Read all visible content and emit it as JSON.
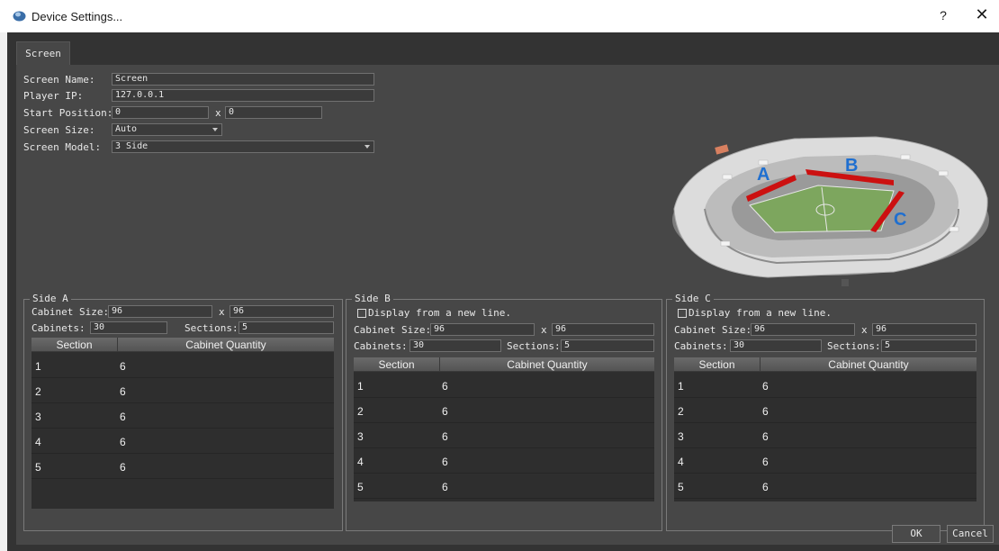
{
  "window": {
    "title": "Device Settings...",
    "help": "?",
    "close": "✕"
  },
  "tabs": [
    {
      "label": "Screen"
    }
  ],
  "form": {
    "screen_name_label": "Screen Name:",
    "screen_name_value": "Screen",
    "player_ip_label": "Player IP:",
    "player_ip_value": "127.0.0.1",
    "start_position_label": "Start Position:",
    "start_x": "0",
    "x_sep": "x",
    "start_y": "0",
    "screen_size_label": "Screen Size:",
    "screen_size_value": "Auto",
    "screen_model_label": "Screen Model:",
    "screen_model_value": "3 Side"
  },
  "preview": {
    "labels": [
      "A",
      "B",
      "C"
    ]
  },
  "sides": [
    {
      "title": "Side A",
      "cabinet_size_label": "Cabinet Size:",
      "cab_w": "96",
      "x_sep": "x",
      "cab_h": "96",
      "cabinets_label": "Cabinets:",
      "cabinets": "30",
      "sections_label": "Sections:",
      "sections": "5",
      "col_section": "Section",
      "col_quantity": "Cabinet Quantity",
      "rows": [
        [
          "1",
          "6"
        ],
        [
          "2",
          "6"
        ],
        [
          "3",
          "6"
        ],
        [
          "4",
          "6"
        ],
        [
          "5",
          "6"
        ]
      ]
    },
    {
      "title": "Side B",
      "newline_label": "Display from a new line.",
      "cabinet_size_label": "Cabinet Size:",
      "cab_w": "96",
      "x_sep": "x",
      "cab_h": "96",
      "cabinets_label": "Cabinets:",
      "cabinets": "30",
      "sections_label": "Sections:",
      "sections": "5",
      "col_section": "Section",
      "col_quantity": "Cabinet Quantity",
      "rows": [
        [
          "1",
          "6"
        ],
        [
          "2",
          "6"
        ],
        [
          "3",
          "6"
        ],
        [
          "4",
          "6"
        ],
        [
          "5",
          "6"
        ]
      ]
    },
    {
      "title": "Side C",
      "newline_label": "Display from a new line.",
      "cabinet_size_label": "Cabinet Size:",
      "cab_w": "96",
      "x_sep": "x",
      "cab_h": "96",
      "cabinets_label": "Cabinets:",
      "cabinets": "30",
      "sections_label": "Sections:",
      "sections": "5",
      "col_section": "Section",
      "col_quantity": "Cabinet Quantity",
      "rows": [
        [
          "1",
          "6"
        ],
        [
          "2",
          "6"
        ],
        [
          "3",
          "6"
        ],
        [
          "4",
          "6"
        ],
        [
          "5",
          "6"
        ]
      ]
    }
  ],
  "buttons": {
    "ok": "OK",
    "cancel": "Cancel"
  },
  "colors": {
    "background": "#333333",
    "panel": "#474747",
    "led_screen": "#cc1010",
    "label_blue": "#1f6fd0"
  }
}
